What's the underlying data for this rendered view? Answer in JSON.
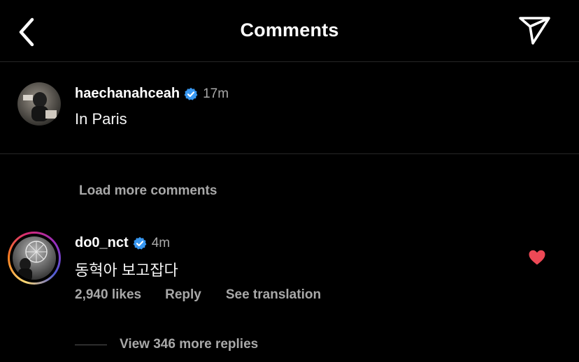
{
  "header": {
    "title": "Comments",
    "back_icon": "chevron-left-icon",
    "send_icon": "paper-plane-icon"
  },
  "caption": {
    "username": "haechanahceah",
    "verified": true,
    "time": "17m",
    "text": "In Paris"
  },
  "load_more": "Load more comments",
  "comment": {
    "username": "do0_nct",
    "verified": true,
    "time": "4m",
    "text": "동혁아 보고잡다",
    "likes": "2,940 likes",
    "reply_label": "Reply",
    "translate_label": "See translation",
    "liked": true,
    "view_replies": "View 346 more replies"
  },
  "colors": {
    "background": "#000000",
    "verified_blue": "#3897f0",
    "like_red": "#ed4956",
    "secondary_text": "#a8a8a8"
  }
}
